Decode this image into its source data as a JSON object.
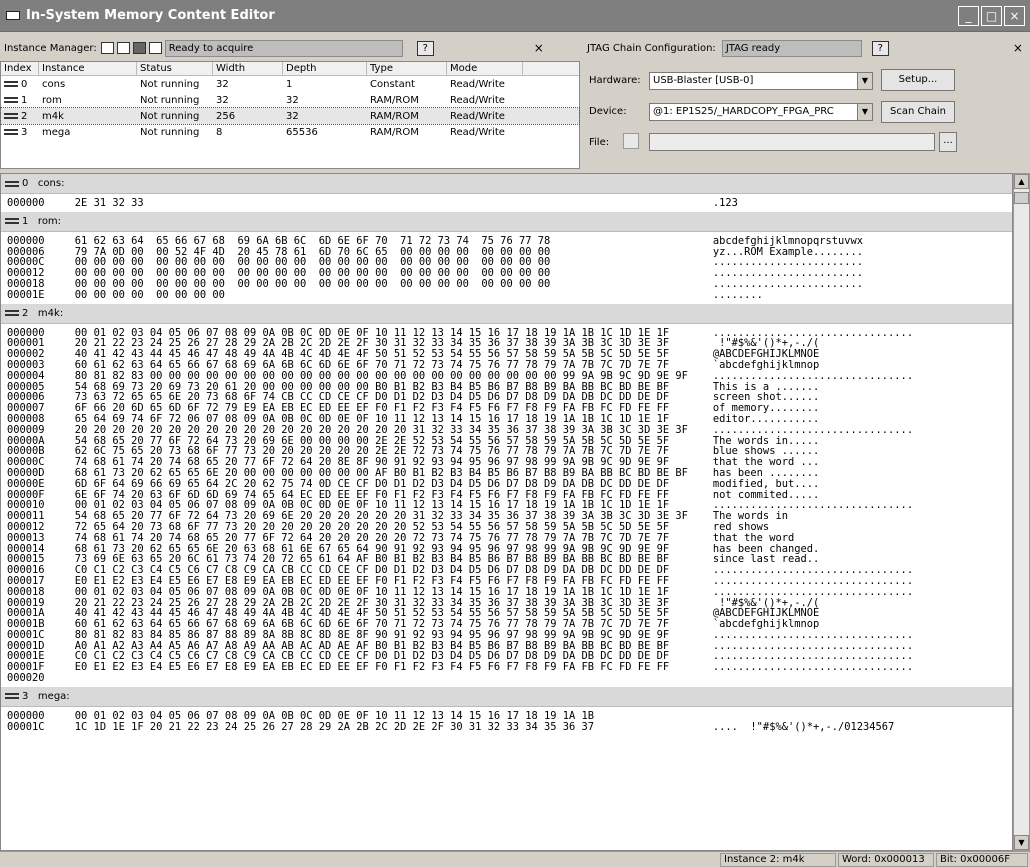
{
  "window": {
    "title": "In-System Memory Content Editor",
    "buttons": [
      "_",
      "□",
      "×"
    ]
  },
  "instance_manager": {
    "label": "Instance Manager:",
    "status": "Ready to acquire",
    "help": "?",
    "close": "×",
    "columns": [
      "Index",
      "Instance",
      "Status",
      "Width",
      "Depth",
      "Type",
      "Mode"
    ],
    "rows": [
      {
        "index": "0",
        "instance": "cons",
        "status": "Not running",
        "width": "32",
        "depth": "1",
        "type": "Constant",
        "mode": "Read/Write"
      },
      {
        "index": "1",
        "instance": "rom",
        "status": "Not running",
        "width": "32",
        "depth": "32",
        "type": "RAM/ROM",
        "mode": "Read/Write"
      },
      {
        "index": "2",
        "instance": "m4k",
        "status": "Not running",
        "width": "256",
        "depth": "32",
        "type": "RAM/ROM",
        "mode": "Read/Write"
      },
      {
        "index": "3",
        "instance": "mega",
        "status": "Not running",
        "width": "8",
        "depth": "65536",
        "type": "RAM/ROM",
        "mode": "Read/Write"
      }
    ]
  },
  "jtag": {
    "label": "JTAG Chain Configuration:",
    "status": "JTAG ready",
    "help": "?",
    "close": "×",
    "hardware_label": "Hardware:",
    "hardware_value": "USB-Blaster [USB-0]",
    "setup": "Setup...",
    "device_label": "Device:",
    "device_value": "@1: EP1S25/_HARDCOPY_FPGA_PRC",
    "scan": "Scan Chain",
    "file_label": "File:",
    "file_value": "",
    "browse": "..."
  },
  "sections": [
    {
      "index": "0",
      "name": "cons:",
      "lines": [
        {
          "a": "000000",
          "h": "2E 31 32 33",
          "t": ".123"
        }
      ]
    },
    {
      "index": "1",
      "name": "rom:",
      "lines": [
        {
          "a": "000000",
          "h": "61 62 63 64  65 66 67 68  69 6A 6B 6C  6D 6E 6F 70  71 72 73 74  75 76 77 78",
          "t": "abcdefghijklmnopqrstuvwx"
        },
        {
          "a": "000006",
          "h": "79 7A 0D 00  00 52 4F 4D  20 45 78 61  6D 70 6C 65  00 00 00 00  00 00 00 00",
          "t": "yz...ROM Example........"
        },
        {
          "a": "00000C",
          "h": "00 00 00 00  00 00 00 00  00 00 00 00  00 00 00 00  00 00 00 00  00 00 00 00",
          "t": "........................"
        },
        {
          "a": "000012",
          "h": "00 00 00 00  00 00 00 00  00 00 00 00  00 00 00 00  00 00 00 00  00 00 00 00",
          "t": "........................"
        },
        {
          "a": "000018",
          "h": "00 00 00 00  00 00 00 00  00 00 00 00  00 00 00 00  00 00 00 00  00 00 00 00",
          "t": "........................"
        },
        {
          "a": "00001E",
          "h": "00 00 00 00  00 00 00 00",
          "t": "........"
        }
      ]
    },
    {
      "index": "2",
      "name": "m4k:",
      "lines": [
        {
          "a": "000000",
          "h": "00 01 02 03 04 05 06 07 08 09 0A 0B 0C 0D 0E 0F 10 11 12 13 14 15 16 17 18 19 1A 1B 1C 1D 1E 1F",
          "t": "................................"
        },
        {
          "a": "000001",
          "h": "20 21 22 23 24 25 26 27 28 29 2A 2B 2C 2D 2E 2F 30 31 32 33 34 35 36 37 38 39 3A 3B 3C 3D 3E 3F",
          "t": " !\"#$%&'()*+,-./("
        },
        {
          "a": "000002",
          "h": "40 41 42 43 44 45 46 47 48 49 4A 4B 4C 4D 4E 4F 50 51 52 53 54 55 56 57 58 59 5A 5B 5C 5D 5E 5F",
          "t": "@ABCDEFGHIJKLMNOE"
        },
        {
          "a": "000003",
          "h": "60 61 62 63 64 65 66 67 68 69 6A 6B 6C 6D 6E 6F 70 71 72 73 74 75 76 77 78 79 7A 7B 7C 7D 7E 7F",
          "t": "`abcdefghijklmnop"
        },
        {
          "a": "000004",
          "h": "80 81 82 83 00 00 00 00 00 00 00 00 00 00 00 00 00 00 00 00 00 00 00 00 00 00 99 9A 9B 9C 9D 9E 9F",
          "t": "................................"
        },
        {
          "a": "000005",
          "h": "54 68 69 73 20 69 73 20 61 20 00 00 00 00 00 00 B0 B1 B2 B3 B4 B5 B6 B7 B8 B9 BA BB BC BD BE BF",
          "t": "This is a ......."
        },
        {
          "a": "000006",
          "h": "73 63 72 65 65 6E 20 73 68 6F 74 CB CC CD CE CF D0 D1 D2 D3 D4 D5 D6 D7 D8 D9 DA DB DC DD DE DF",
          "t": "screen shot......"
        },
        {
          "a": "000007",
          "h": "6F 66 20 6D 65 6D 6F 72 79 E9 EA EB EC ED EE EF F0 F1 F2 F3 F4 F5 F6 F7 F8 F9 FA FB FC FD FE FF",
          "t": "of memory........"
        },
        {
          "a": "000008",
          "h": "65 64 69 74 6F 72 06 07 08 09 0A 0B 0C 0D 0E 0F 10 11 12 13 14 15 16 17 18 19 1A 1B 1C 1D 1E 1F",
          "t": "editor..........."
        },
        {
          "a": "000009",
          "h": "20 20 20 20 20 20 20 20 20 20 20 20 20 20 20 20 20 20 31 32 33 34 35 36 37 38 39 3A 3B 3C 3D 3E 3F",
          "t": "................................"
        },
        {
          "a": "00000A",
          "h": "54 68 65 20 77 6F 72 64 73 20 69 6E 00 00 00 00 2E 2E 52 53 54 55 56 57 58 59 5A 5B 5C 5D 5E 5F",
          "t": "The words in....."
        },
        {
          "a": "00000B",
          "h": "62 6C 75 65 20 73 68 6F 77 73 20 20 20 20 20 20 2E 2E 72 73 74 75 76 77 78 79 7A 7B 7C 7D 7E 7F",
          "t": "blue shows ......"
        },
        {
          "a": "00000C",
          "h": "74 68 61 74 20 74 68 65 20 77 6F 72 64 20 8E 8F 90 91 92 93 94 95 96 97 98 99 9A 9B 9C 9D 9E 9F",
          "t": "that the word ..."
        },
        {
          "a": "00000D",
          "h": "68 61 73 20 62 65 65 6E 20 00 00 00 00 00 00 00 AF B0 B1 B2 B3 B4 B5 B6 B7 B8 B9 BA BB BC BD BE BF",
          "t": "has been ........"
        },
        {
          "a": "00000E",
          "h": "6D 6F 64 69 66 69 65 64 2C 20 62 75 74 0D CE CF D0 D1 D2 D3 D4 D5 D6 D7 D8 D9 DA DB DC DD DE DF",
          "t": "modified, but...."
        },
        {
          "a": "00000F",
          "h": "6E 6F 74 20 63 6F 6D 6D 69 74 65 64 EC ED EE EF F0 F1 F2 F3 F4 F5 F6 F7 F8 F9 FA FB FC FD FE FF",
          "t": "not commited....."
        },
        {
          "a": "000010",
          "h": "00 01 02 03 04 05 06 07 08 09 0A 0B 0C 0D 0E 0F 10 11 12 13 14 15 16 17 18 19 1A 1B 1C 1D 1E 1F",
          "t": "................................"
        },
        {
          "a": "000011",
          "h": "54 68 65 20 77 6F 72 64 73 20 69 6E 20 20 20 20 20 20 31 32 33 34 35 36 37 38 39 3A 3B 3C 3D 3E 3F",
          "t": "The words in"
        },
        {
          "a": "000012",
          "h": "72 65 64 20 73 68 6F 77 73 20 20 20 20 20 20 20 20 20 52 53 54 55 56 57 58 59 5A 5B 5C 5D 5E 5F",
          "t": "red shows"
        },
        {
          "a": "000013",
          "h": "74 68 61 74 20 74 68 65 20 77 6F 72 64 20 20 20 20 20 72 73 74 75 76 77 78 79 7A 7B 7C 7D 7E 7F",
          "t": "that the word"
        },
        {
          "a": "000014",
          "h": "68 61 73 20 62 65 65 6E 20 63 68 61 6E 67 65 64 90 91 92 93 94 95 96 97 98 99 9A 9B 9C 9D 9E 9F",
          "t": "has been changed."
        },
        {
          "a": "000015",
          "h": "73 69 6E 63 65 20 6C 61 73 74 20 72 65 61 64 AF B0 B1 B2 B3 B4 B5 B6 B7 B8 B9 BA BB BC BD BE BF",
          "t": "since last read.."
        },
        {
          "a": "000016",
          "h": "C0 C1 C2 C3 C4 C5 C6 C7 C8 C9 CA CB CC CD CE CF D0 D1 D2 D3 D4 D5 D6 D7 D8 D9 DA DB DC DD DE DF",
          "t": "................................"
        },
        {
          "a": "000017",
          "h": "E0 E1 E2 E3 E4 E5 E6 E7 E8 E9 EA EB EC ED EE EF F0 F1 F2 F3 F4 F5 F6 F7 F8 F9 FA FB FC FD FE FF",
          "t": "................................"
        },
        {
          "a": "000018",
          "h": "00 01 02 03 04 05 06 07 08 09 0A 0B 0C 0D 0E 0F 10 11 12 13 14 15 16 17 18 19 1A 1B 1C 1D 1E 1F",
          "t": "................................"
        },
        {
          "a": "000019",
          "h": "20 21 22 23 24 25 26 27 28 29 2A 2B 2C 2D 2E 2F 30 31 32 33 34 35 36 37 38 39 3A 3B 3C 3D 3E 3F",
          "t": " !\"#$%&'()*+,-./("
        },
        {
          "a": "00001A",
          "h": "40 41 42 43 44 45 46 47 48 49 4A 4B 4C 4D 4E 4F 50 51 52 53 54 55 56 57 58 59 5A 5B 5C 5D 5E 5F",
          "t": "@ABCDEFGHIJKLMNOE"
        },
        {
          "a": "00001B",
          "h": "60 61 62 63 64 65 66 67 68 69 6A 6B 6C 6D 6E 6F 70 71 72 73 74 75 76 77 78 79 7A 7B 7C 7D 7E 7F",
          "t": "`abcdefghijklmnop"
        },
        {
          "a": "00001C",
          "h": "80 81 82 83 84 85 86 87 88 89 8A 8B 8C 8D 8E 8F 90 91 92 93 94 95 96 97 98 99 9A 9B 9C 9D 9E 9F",
          "t": "................................"
        },
        {
          "a": "00001D",
          "h": "A0 A1 A2 A3 A4 A5 A6 A7 A8 A9 AA AB AC AD AE AF B0 B1 B2 B3 B4 B5 B6 B7 B8 B9 BA BB BC BD BE BF",
          "t": "................................"
        },
        {
          "a": "00001E",
          "h": "C0 C1 C2 C3 C4 C5 C6 C7 C8 C9 CA CB CC CD CE CF D0 D1 D2 D3 D4 D5 D6 D7 D8 D9 DA DB DC DD DE DF",
          "t": "................................"
        },
        {
          "a": "00001F",
          "h": "E0 E1 E2 E3 E4 E5 E6 E7 E8 E9 EA EB EC ED EE EF F0 F1 F2 F3 F4 F5 F6 F7 F8 F9 FA FB FC FD FE FF",
          "t": "................................"
        },
        {
          "a": "000020",
          "h": "",
          "t": ""
        }
      ]
    },
    {
      "index": "3",
      "name": "mega:",
      "lines": [
        {
          "a": "000000",
          "h": "00 01 02 03 04 05 06 07 08 09 0A 0B 0C 0D 0E 0F 10 11 12 13 14 15 16 17 18 19 1A 1B",
          "t": ""
        },
        {
          "a": "00001C",
          "h": "1C 1D 1E 1F 20 21 22 23 24 25 26 27 28 29 2A 2B 2C 2D 2E 2F 30 31 32 33 34 35 36 37",
          "t": "....  !\"#$%&'()*+,-./01234567"
        }
      ]
    }
  ],
  "statusbar": {
    "instance": "Instance 2: m4k",
    "word": "Word: 0x000013",
    "bit": "Bit: 0x00006F"
  }
}
